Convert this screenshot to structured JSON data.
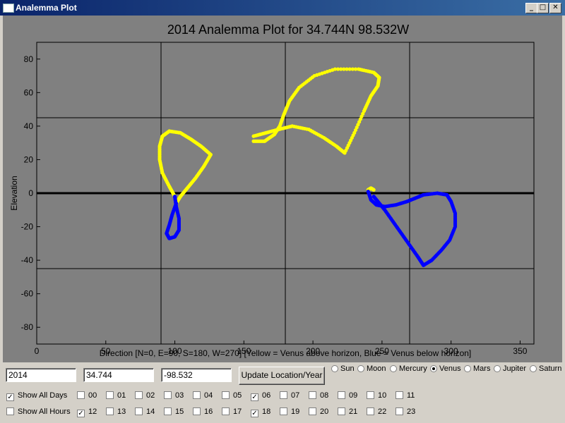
{
  "window": {
    "title": "Analemma Plot",
    "minimize_glyph": "_",
    "maximize_glyph": "□",
    "close_glyph": "✕"
  },
  "plot": {
    "title": "2014 Analemma Plot for  34.744N  98.532W",
    "xlabel": "Direction [N=0, E=90, S=180, W=270] [Yellow = Venus above horizon, Blue = Venus below horizon]",
    "ylabel": "Elevation",
    "background": "#808080",
    "above_color": "#ffff00",
    "below_color": "#0000ff"
  },
  "chart_data": {
    "type": "scatter",
    "title": "2014 Analemma Plot for  34.744N  98.532W",
    "xlabel": "Direction [N=0, E=90, S=180, W=270] [Yellow = Venus above horizon, Blue = Venus below horizon]",
    "ylabel": "Elevation",
    "xlim": [
      0,
      360
    ],
    "ylim": [
      -90,
      90
    ],
    "xticks": [
      0,
      50,
      100,
      150,
      200,
      250,
      300,
      350
    ],
    "yticks": [
      -80,
      -60,
      -40,
      -20,
      0,
      20,
      40,
      60,
      80
    ],
    "reference_lines": {
      "x": [
        90,
        180,
        270
      ],
      "y": [
        45,
        0,
        -45
      ]
    },
    "series": [
      {
        "color": "#ffff00",
        "points": [
          [
            100,
            -2
          ],
          [
            96,
            4
          ],
          [
            91,
            12
          ],
          [
            89,
            20
          ],
          [
            89,
            28
          ],
          [
            91,
            34
          ],
          [
            96,
            37
          ],
          [
            104,
            36
          ],
          [
            112,
            32
          ],
          [
            119,
            28
          ],
          [
            126,
            23
          ],
          [
            121,
            16
          ],
          [
            115,
            9
          ],
          [
            109,
            3
          ],
          [
            104,
            -2
          ],
          [
            101,
            -6
          ]
        ]
      },
      {
        "color": "#0000ff",
        "points": [
          [
            101,
            -6
          ],
          [
            98,
            -13
          ],
          [
            96,
            -19
          ],
          [
            94,
            -24
          ],
          [
            96,
            -27
          ],
          [
            100,
            -26
          ],
          [
            103,
            -22
          ],
          [
            103,
            -15
          ],
          [
            101,
            -8
          ],
          [
            100,
            -2
          ]
        ]
      },
      {
        "color": "#ffff00",
        "points": [
          [
            157,
            34
          ],
          [
            166,
            36
          ],
          [
            175,
            38
          ],
          [
            185,
            40
          ],
          [
            197,
            38
          ],
          [
            208,
            33
          ],
          [
            217,
            28
          ],
          [
            223,
            24
          ],
          [
            230,
            36
          ],
          [
            237,
            49
          ],
          [
            242,
            58
          ],
          [
            247,
            64
          ],
          [
            248,
            69
          ],
          [
            244,
            72
          ],
          [
            233,
            74
          ],
          [
            216,
            74
          ],
          [
            201,
            70
          ],
          [
            190,
            63
          ],
          [
            183,
            55
          ],
          [
            179,
            47
          ],
          [
            176,
            40
          ],
          [
            172,
            35
          ],
          [
            165,
            31
          ],
          [
            157,
            31
          ]
        ]
      },
      {
        "color": "#ffff00",
        "points": [
          [
            240,
            2
          ],
          [
            242,
            3
          ],
          [
            244,
            2
          ]
        ]
      },
      {
        "color": "#0000ff",
        "points": [
          [
            240,
            1
          ],
          [
            242,
            -4
          ],
          [
            246,
            -7
          ],
          [
            252,
            -8
          ],
          [
            260,
            -7
          ],
          [
            268,
            -5
          ],
          [
            274,
            -3
          ],
          [
            280,
            -1
          ],
          [
            290,
            0
          ],
          [
            297,
            -1
          ],
          [
            300,
            -5
          ],
          [
            303,
            -12
          ],
          [
            303,
            -20
          ],
          [
            299,
            -28
          ],
          [
            293,
            -34
          ],
          [
            286,
            -40
          ],
          [
            280,
            -43
          ],
          [
            276,
            -38
          ],
          [
            270,
            -31
          ],
          [
            264,
            -24
          ],
          [
            258,
            -17
          ],
          [
            252,
            -10
          ],
          [
            247,
            -5
          ],
          [
            244,
            -2
          ]
        ]
      }
    ]
  },
  "controls": {
    "year_value": "2014",
    "lat_value": "34.744",
    "lon_value": "-98.532",
    "update_label": "Update Location/Year"
  },
  "bodies": [
    {
      "label": "Sun",
      "selected": false
    },
    {
      "label": "Moon",
      "selected": false
    },
    {
      "label": "Mercury",
      "selected": false
    },
    {
      "label": "Venus",
      "selected": true
    },
    {
      "label": "Mars",
      "selected": false
    },
    {
      "label": "Jupiter",
      "selected": false
    },
    {
      "label": "Saturn",
      "selected": false
    }
  ],
  "show_all_days": {
    "label": "Show All Days",
    "checked": true
  },
  "show_all_hours": {
    "label": "Show All Hours",
    "checked": false
  },
  "hours_row1": [
    {
      "label": "00",
      "checked": false
    },
    {
      "label": "01",
      "checked": false
    },
    {
      "label": "02",
      "checked": false
    },
    {
      "label": "03",
      "checked": false
    },
    {
      "label": "04",
      "checked": false
    },
    {
      "label": "05",
      "checked": false
    },
    {
      "label": "06",
      "checked": true
    },
    {
      "label": "07",
      "checked": false
    },
    {
      "label": "08",
      "checked": false
    },
    {
      "label": "09",
      "checked": false
    },
    {
      "label": "10",
      "checked": false
    },
    {
      "label": "11",
      "checked": false
    }
  ],
  "hours_row2": [
    {
      "label": "12",
      "checked": true
    },
    {
      "label": "13",
      "checked": false
    },
    {
      "label": "14",
      "checked": false
    },
    {
      "label": "15",
      "checked": false
    },
    {
      "label": "16",
      "checked": false
    },
    {
      "label": "17",
      "checked": false
    },
    {
      "label": "18",
      "checked": true
    },
    {
      "label": "19",
      "checked": false
    },
    {
      "label": "20",
      "checked": false
    },
    {
      "label": "21",
      "checked": false
    },
    {
      "label": "22",
      "checked": false
    },
    {
      "label": "23",
      "checked": false
    }
  ]
}
